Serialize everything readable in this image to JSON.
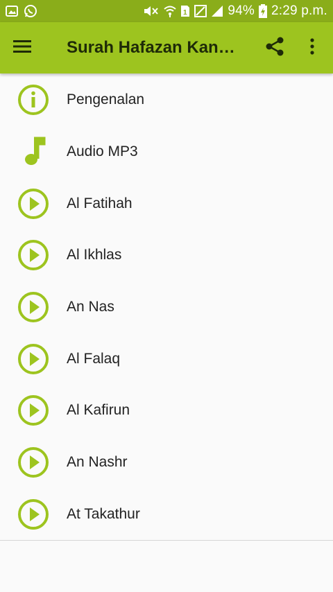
{
  "status_bar": {
    "battery": "94%",
    "time": "2:29 p.m."
  },
  "app_bar": {
    "title": "Surah Hafazan Kan…",
    "menu_icon": "hamburger-menu-icon",
    "share_icon": "share-icon",
    "more_icon": "more-vert-icon"
  },
  "colors": {
    "status_bar": "#8aad1a",
    "app_bar": "#9dc41f",
    "accent": "#9dc41f",
    "background": "#fafafa"
  },
  "menu": {
    "items": [
      {
        "label": "Pengenalan",
        "icon": "info-icon"
      },
      {
        "label": "Audio MP3",
        "icon": "music-note-icon"
      },
      {
        "label": "Al Fatihah",
        "icon": "play-circle-icon"
      },
      {
        "label": "Al Ikhlas",
        "icon": "play-circle-icon"
      },
      {
        "label": "An Nas",
        "icon": "play-circle-icon"
      },
      {
        "label": "Al Falaq",
        "icon": "play-circle-icon"
      },
      {
        "label": "Al Kafirun",
        "icon": "play-circle-icon"
      },
      {
        "label": "An Nashr",
        "icon": "play-circle-icon"
      },
      {
        "label": "At Takathur",
        "icon": "play-circle-icon"
      }
    ]
  }
}
